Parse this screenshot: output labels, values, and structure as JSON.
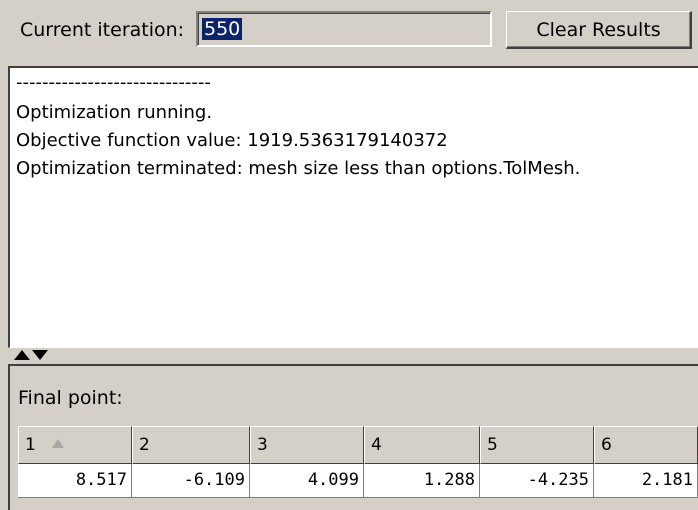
{
  "toolbar": {
    "iteration_label": "Current iteration:",
    "iteration_value": "550",
    "clear_label": "Clear Results"
  },
  "log": {
    "lines": [
      "------------------------------",
      "Optimization running.",
      "Objective function value: 1919.5363179140372",
      "Optimization terminated: mesh size less than options.TolMesh."
    ]
  },
  "results": {
    "title": "Final point:",
    "columns": [
      "1",
      "2",
      "3",
      "4",
      "5",
      "6"
    ],
    "values": [
      "8.517",
      "-6.109",
      "4.099",
      "1.288",
      "-4.235",
      "2.181"
    ],
    "sort_icon": "sort-ascending-icon"
  },
  "colors": {
    "panel_bg": "#d4d0c8",
    "selection_bg": "#0a246a",
    "selection_fg": "#ffffff"
  }
}
